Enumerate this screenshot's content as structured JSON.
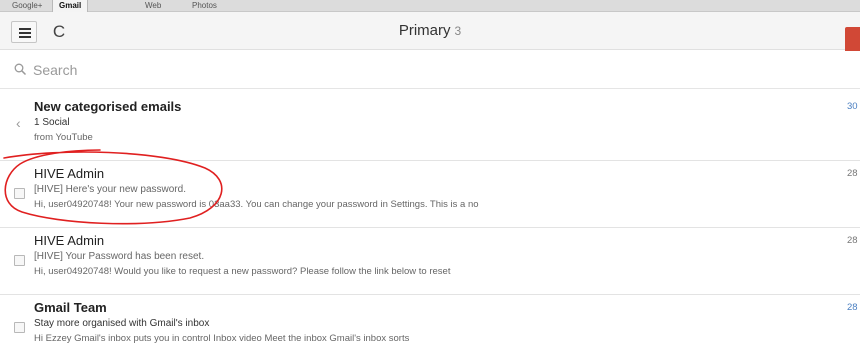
{
  "tabs": [
    {
      "label": "Google+",
      "active": false
    },
    {
      "label": "Gmail",
      "active": true
    },
    {
      "label": "Web",
      "active": false
    },
    {
      "label": "Photos",
      "active": false
    }
  ],
  "header": {
    "title": "Primary",
    "count": "3",
    "menu_icon": "hamburger-menu-icon",
    "refresh_icon": "refresh-icon",
    "refresh_glyph": "C"
  },
  "search": {
    "placeholder": "Search",
    "icon": "search-icon"
  },
  "emails": [
    {
      "sender": "New categorised emails",
      "subject": "1 Social",
      "snippet": "from YouTube",
      "date": "30",
      "unread": true
    },
    {
      "sender": "HIVE Admin",
      "subject": "[HIVE] Here's your new password.",
      "snippet": "Hi, user04920748! Your new password is 03aa33. You can change your password in Settings. This is a no",
      "date": "28",
      "unread": false
    },
    {
      "sender": "HIVE Admin",
      "subject": "[HIVE] Your Password has been reset.",
      "snippet": "Hi, user04920748! Would you like to request a new password? Please follow the link below to reset",
      "date": "28",
      "unread": false
    },
    {
      "sender": "Gmail Team",
      "subject": "Stay more organised with Gmail's inbox",
      "snippet": "Hi Ezzey Gmail's inbox puts you in control Inbox video Meet the inbox Gmail's inbox sorts",
      "date": "28",
      "unread": true
    }
  ],
  "colors": {
    "compose_red": "#d14836",
    "date_blue": "#4a7fc1",
    "annotation_red": "#e02020"
  }
}
